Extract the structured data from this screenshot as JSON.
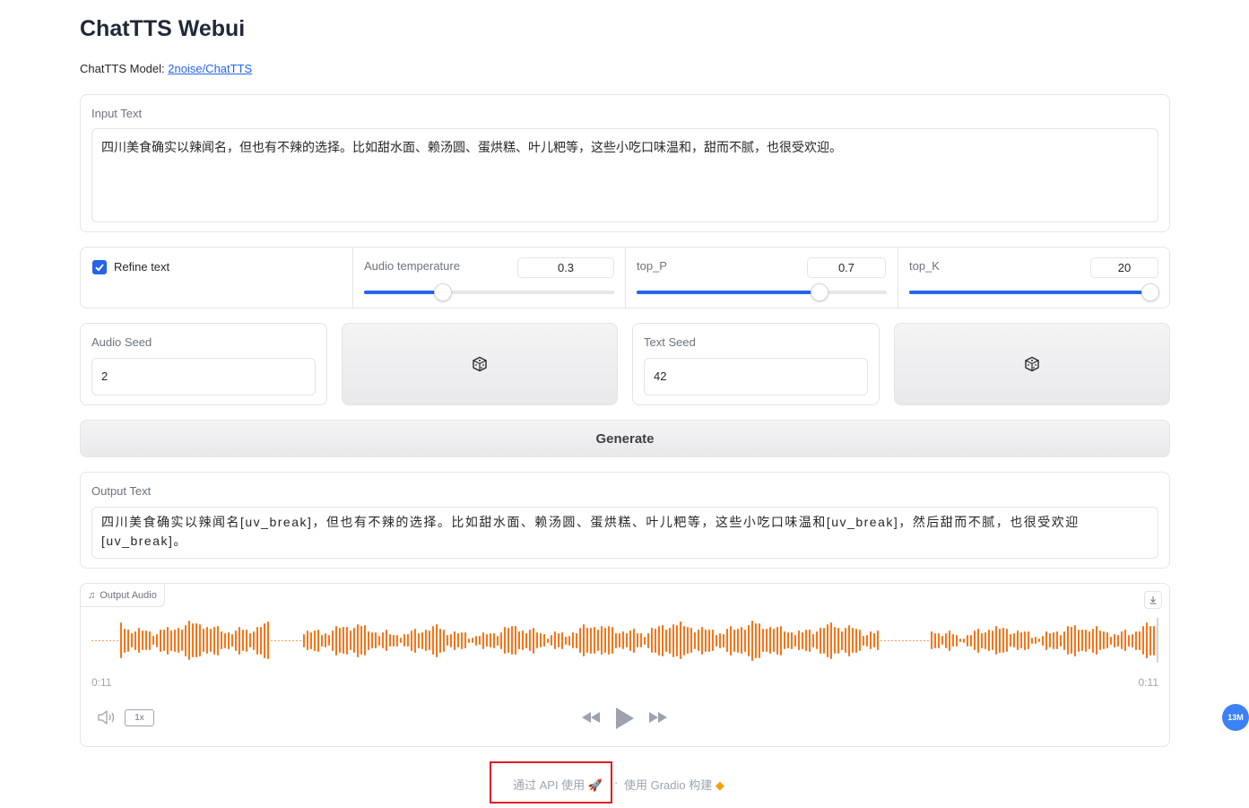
{
  "header": {
    "title": "ChatTTS Webui",
    "model_prefix": "ChatTTS Model: ",
    "model_link": "2noise/ChatTTS"
  },
  "input": {
    "label": "Input Text",
    "value": "四川美食确实以辣闻名，但也有不辣的选择。比如甜水面、赖汤圆、蛋烘糕、叶儿粑等，这些小吃口味温和，甜而不腻，也很受欢迎。"
  },
  "controls": {
    "refine_label": "Refine text",
    "refine_checked": true,
    "temperature": {
      "label": "Audio temperature",
      "value": "0.3",
      "fraction": 0.3
    },
    "top_p": {
      "label": "top_P",
      "value": "0.7",
      "fraction": 0.73
    },
    "top_k": {
      "label": "top_K",
      "value": "20",
      "fraction": 1.0
    }
  },
  "seeds": {
    "audio_label": "Audio Seed",
    "audio_value": "2",
    "text_label": "Text Seed",
    "text_value": "42"
  },
  "generate_label": "Generate",
  "output": {
    "label": "Output Text",
    "value": "四川美食确实以辣闻名[uv_break]，但也有不辣的选择。比如甜水面、赖汤圆、蛋烘糕、叶儿粑等，这些小吃口味温和[uv_break]，然后甜而不腻，也很受欢迎[uv_break]。"
  },
  "audio": {
    "label": "Output Audio",
    "time_current": "0:11",
    "time_total": "0:11",
    "speed": "1x",
    "accent": "#f97316"
  },
  "footer": {
    "api_text": "通过 API 使用",
    "separator": "·",
    "gradio_text": "使用 Gradio 构建"
  },
  "badge": "13M"
}
